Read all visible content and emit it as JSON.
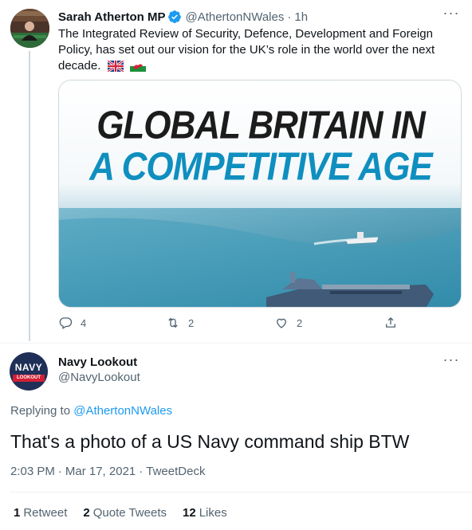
{
  "tweet1": {
    "name": "Sarah Atherton MP",
    "handle": "@AthertonNWales",
    "separator": "·",
    "time": "1h",
    "text": "The Integrated Review of Security, Defence, Development and Foreign Policy, has set out our vision for the UK’s role in the world over the next decade.",
    "flags": [
      "union-jack-flag-icon",
      "welsh-flag-icon"
    ],
    "image": {
      "headline_line1": "GLOBAL BRITAIN IN",
      "headline_line2": "A COMPETITIVE AGE"
    },
    "actions": {
      "replies": "4",
      "retweets": "2",
      "likes": "2"
    }
  },
  "tweet2": {
    "name": "Navy Lookout",
    "handle": "@NavyLookout",
    "avatar_text": "NAVY",
    "avatar_subtext": "LOOKOUT",
    "replying_prefix": "Replying to",
    "replying_to": "@AthertonNWales",
    "text": "That's a photo of a US Navy command ship BTW",
    "time": "2:03 PM",
    "date": "Mar 17, 2021",
    "source": "TweetDeck",
    "meta_separator": "·",
    "stats": {
      "retweets_count": "1",
      "retweets_label": "Retweet",
      "quotes_count": "2",
      "quotes_label": "Quote Tweets",
      "likes_count": "12",
      "likes_label": "Likes"
    }
  },
  "colors": {
    "text": "#0f1419",
    "secondary": "#536471",
    "link": "#1d9bf0",
    "verified": "#1d9bf0",
    "headline_blue": "#0f8fbf",
    "navy_logo": "#1f2f57",
    "navy_logo_band": "#d21f35"
  }
}
